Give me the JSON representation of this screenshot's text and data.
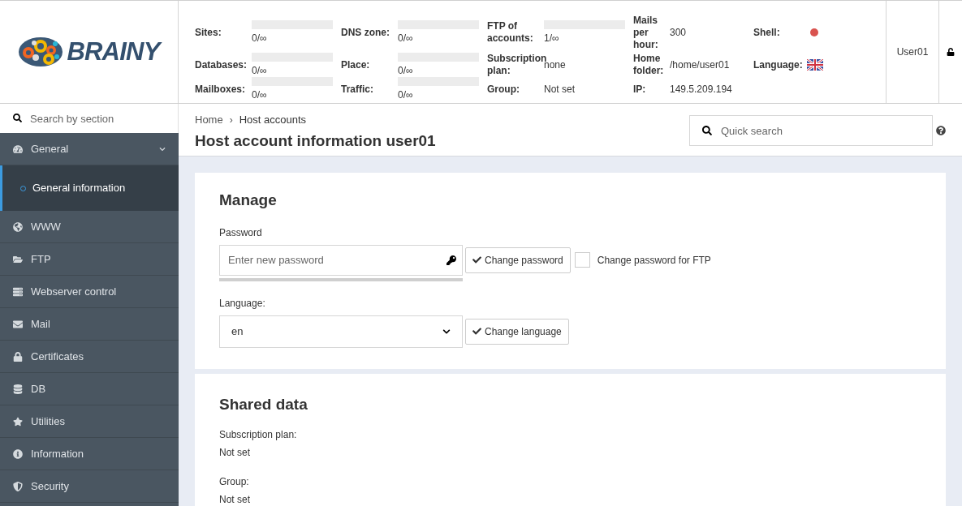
{
  "logo": {
    "text": "BRAINY"
  },
  "stats": [
    [
      {
        "label": "Sites:",
        "kind": "usage",
        "value": "0/∞",
        "level": 0
      },
      {
        "label": "Databases:",
        "kind": "usage",
        "value": "0/∞",
        "level": 0
      },
      {
        "label": "Mailboxes:",
        "kind": "usage",
        "value": "0/∞",
        "level": 0
      }
    ],
    [
      {
        "label": "DNS zone:",
        "kind": "usage",
        "value": "0/∞",
        "level": 0
      },
      {
        "label": "Place:",
        "kind": "usage",
        "value": "0/∞",
        "level": 0
      },
      {
        "label": "Traffic:",
        "kind": "usage",
        "value": "0/∞",
        "level": 0
      }
    ],
    [
      {
        "label": "FTP of accounts:",
        "kind": "usage",
        "value": "1/∞",
        "level": 0
      },
      {
        "label": "Subscription plan:",
        "kind": "text",
        "value": "none"
      },
      {
        "label": "Group:",
        "kind": "text",
        "value": "Not set"
      }
    ],
    [
      {
        "label": "Mails per hour:",
        "kind": "text",
        "value": "300"
      },
      {
        "label": "Home folder:",
        "kind": "text",
        "value": "/home/user01"
      },
      {
        "label": "IP:",
        "kind": "text",
        "value": "149.5.209.194"
      }
    ],
    [
      {
        "label": "Shell:",
        "kind": "dot",
        "color": "#d9534f"
      },
      {
        "label": "Language:",
        "kind": "flag"
      }
    ]
  ],
  "user": "User01",
  "sidebar": {
    "search_placeholder": "Search by section",
    "items": [
      {
        "label": "General",
        "expanded": true,
        "selected": false,
        "children": [
          {
            "label": "General information",
            "selected": true
          }
        ]
      },
      {
        "label": "WWW",
        "selected": false
      },
      {
        "label": "FTP",
        "selected": false
      },
      {
        "label": "Webserver control",
        "selected": false
      },
      {
        "label": "Mail",
        "selected": false
      },
      {
        "label": "Certificates",
        "selected": false
      },
      {
        "label": "DB",
        "selected": false
      },
      {
        "label": "Utilities",
        "selected": false
      },
      {
        "label": "Information",
        "selected": false
      },
      {
        "label": "Security",
        "selected": false
      }
    ]
  },
  "breadcrumbs": [
    "Home",
    "Host accounts"
  ],
  "breadcrumb_separator": "›",
  "page_title": "Host account information user01",
  "quick_search": {
    "placeholder": "Quick search"
  },
  "manage": {
    "title": "Manage",
    "password_label": "Password",
    "password_placeholder": "Enter new password",
    "password_strength": {
      "level": 0
    },
    "change_password": "Change password",
    "ftp_checkbox": {
      "label": "Change password for FTP",
      "checked": false
    },
    "language_label": "Language:",
    "language_value": "en",
    "change_language": "Change language"
  },
  "shared": {
    "title": "Shared data",
    "fields": [
      {
        "label": "Subscription plan:",
        "value": "Not set"
      },
      {
        "label": "Group:",
        "value": "Not set"
      }
    ]
  }
}
